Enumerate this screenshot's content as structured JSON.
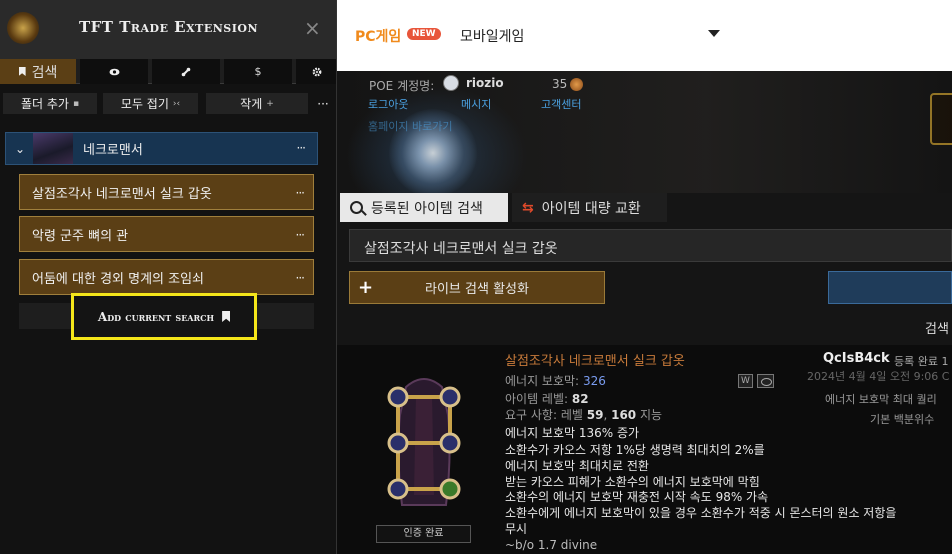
{
  "extension": {
    "title": "TFT Trade Extension",
    "close_icon": "×",
    "tabs": {
      "search_label": "검색",
      "eye_icon": "eye-icon",
      "sync_icon": "sync-icon",
      "dollar_label": "$",
      "gear_icon": "gear-icon"
    },
    "toolbar": {
      "add_folder_label": "폴더 추가",
      "collapse_all_label": "모두 접기",
      "collapse_sub": "›‹",
      "small_label": "작게",
      "small_sub": "+",
      "more_label": "···"
    },
    "folder": {
      "name": "네크로맨서",
      "chevron": "⌄",
      "more_label": "···"
    },
    "saved_searches": [
      {
        "label": "살점조각사 네크로맨서 실크 갑옷",
        "more": "···"
      },
      {
        "label": "악령 군주 뼈의 관",
        "more": "···"
      },
      {
        "label": "어둠에 대한 경외 명계의 조임쇠",
        "more": "···"
      }
    ],
    "add_current_search_label": "Add current search"
  },
  "site": {
    "nav": {
      "pc_label": "PC게임",
      "new_badge": "NEW",
      "mobile_label": "모바일게임"
    },
    "account": {
      "label": "POE 계정명:",
      "name": "riozio",
      "coins": "35",
      "links": {
        "logout": "로그아웃",
        "message": "메시지",
        "support": "고객센터",
        "other": "홈페이지 바로가기"
      }
    },
    "tabs": {
      "search_label": "등록된 아이템 검색",
      "bulk_label": "아이템 대량 교환",
      "bulk_icon": "⇆"
    },
    "search_value": "살점조각사 네크로맨서 실크 갑옷",
    "live_search": {
      "plus": "+",
      "label": "라이브 검색 활성화"
    },
    "results_label": "검색",
    "result": {
      "name": "살점조각사 네크로맨서 실크 갑옷",
      "es_label": "에너지 보호막:",
      "es_value": "326",
      "ilvl_label": "아이템 레벨:",
      "ilvl_value": "82",
      "req_label": "요구 사항: 레벨",
      "req_level": "59",
      "req_int": "160",
      "req_int_label": "지능",
      "mods": [
        "에너지 보호막 136% 증가",
        "소환수가 카오스 저항 1%당 생명력 최대치의 2%를",
        "에너지 보호막 최대치로 전환",
        "받는 카오스 피해가 소환수의 에너지 보호막에 막힘",
        "소환수의 에너지 보호막 재충전 시작 속도 98% 가속",
        "소환수에게 에너지 보호막이 있을 경우 소환수가 적중 시 몬스터의 원소 저항을",
        "무시"
      ],
      "price": "~b/o 1.7 divine",
      "verified_label": "인증 완료",
      "w_badge": "W",
      "seller": "QcIsB4ck",
      "seller_suffix": "등록 완료 1",
      "listed": "2024년 4월 4일 오전 9:06 C",
      "right_es": "에너지 보호막 최대 퀄리",
      "right_base": "기본 백분위수"
    }
  }
}
